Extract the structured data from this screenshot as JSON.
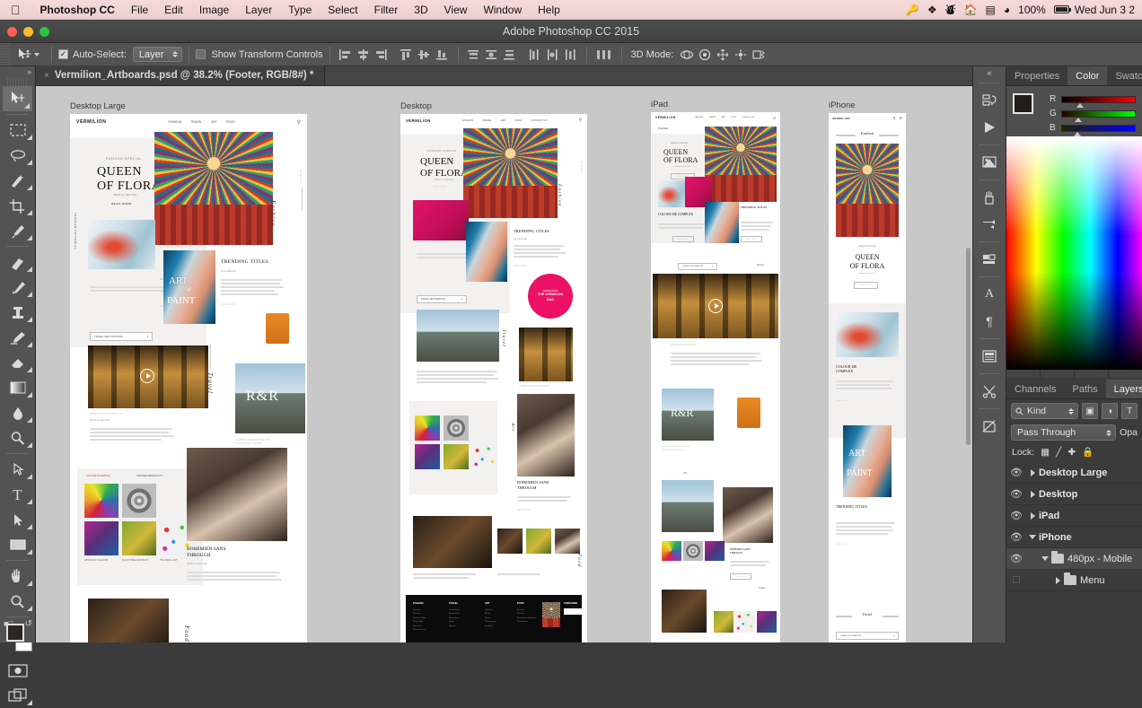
{
  "macmenu": {
    "app": "Photoshop CC",
    "items": [
      "File",
      "Edit",
      "Image",
      "Layer",
      "Type",
      "Select",
      "Filter",
      "3D",
      "View",
      "Window",
      "Help"
    ],
    "status_icons": [
      "keychain-icon",
      "dropbox-icon",
      "creative-cloud-icon",
      "home-icon",
      "airplay-icon",
      "wifi-icon"
    ],
    "battery_percent": "100%",
    "datetime": "Wed Jun 3  2"
  },
  "window": {
    "title": "Adobe Photoshop CC 2015"
  },
  "options": {
    "tool": "move-tool",
    "auto_select_label": "Auto-Select:",
    "auto_select_checked": true,
    "auto_select_value": "Layer",
    "auto_select_options": [
      "Layer",
      "Group"
    ],
    "show_transform_label": "Show Transform Controls",
    "show_transform_checked": false,
    "align_buttons": [
      "align-left-edges",
      "align-horizontal-centers",
      "align-right-edges",
      "align-top-edges",
      "align-vertical-centers",
      "align-bottom-edges"
    ],
    "distribute_buttons": [
      "distribute-top-edges",
      "distribute-vertical-centers",
      "distribute-bottom-edges",
      "distribute-left-edges",
      "distribute-horizontal-centers",
      "distribute-right-edges"
    ],
    "distribute_spacing": "distribute-spacing",
    "mode_3d_label": "3D Mode:",
    "mode_3d_buttons": [
      "orbit-3d",
      "roll-3d",
      "pan-3d",
      "slide-3d",
      "scale-3d"
    ]
  },
  "document": {
    "tab_title": "Vermilion_Artboards.psd @ 38.2% (Footer, RGB/8#) *",
    "close_glyph": "×"
  },
  "toolbar": {
    "tools": [
      {
        "name": "move-tool",
        "active": true
      },
      {
        "name": "rectangular-marquee-tool",
        "active": false
      },
      {
        "name": "lasso-tool",
        "active": false
      },
      {
        "name": "quick-selection-tool",
        "active": false
      },
      {
        "name": "crop-tool",
        "active": false
      },
      {
        "name": "eyedropper-tool",
        "active": false
      },
      {
        "name": "spot-healing-brush-tool",
        "active": false
      },
      {
        "name": "brush-tool",
        "active": false
      },
      {
        "name": "clone-stamp-tool",
        "active": false
      },
      {
        "name": "history-brush-tool",
        "active": false
      },
      {
        "name": "eraser-tool",
        "active": false
      },
      {
        "name": "gradient-tool",
        "active": false
      },
      {
        "name": "blur-tool",
        "active": false
      },
      {
        "name": "dodge-tool",
        "active": false
      },
      {
        "name": "pen-tool",
        "active": false
      },
      {
        "name": "type-tool",
        "active": false
      },
      {
        "name": "path-selection-tool",
        "active": false
      },
      {
        "name": "rectangle-tool",
        "active": false
      },
      {
        "name": "hand-tool",
        "active": false
      },
      {
        "name": "zoom-tool",
        "active": false
      }
    ],
    "type_glyph": "T",
    "foreground_color": "#241c1a",
    "background_color": "#ffffff"
  },
  "rail": {
    "icons": [
      "history-icon",
      "actions-play-icon",
      "adjustments-icon",
      "brush-icon",
      "brush-presets-icon",
      "styles-icon",
      "character-icon",
      "paragraph-icon",
      "libraries-icon",
      "scissors-icon",
      "notes-icon"
    ],
    "character_glyph": "A",
    "paragraph_glyph": "¶",
    "collapse_glyph": "«"
  },
  "color_panel": {
    "tabs": [
      {
        "label": "Properties",
        "active": false
      },
      {
        "label": "Color",
        "active": true
      },
      {
        "label": "Swatches",
        "active": false
      }
    ],
    "channels": [
      {
        "label": "R",
        "value": 36
      },
      {
        "label": "G",
        "value": 28
      },
      {
        "label": "B",
        "value": 26
      }
    ],
    "foreground": "#241c1a",
    "background": "#ffffff"
  },
  "layers_panel": {
    "tabs": [
      {
        "label": "Channels",
        "active": false
      },
      {
        "label": "Paths",
        "active": false
      },
      {
        "label": "Layers",
        "active": true
      }
    ],
    "filter_label": "Kind",
    "filter_icons": [
      "pixel-filter-icon",
      "adjustment-filter-icon",
      "type-filter-icon"
    ],
    "blend_mode": "Pass Through",
    "opacity_label": "Opa",
    "lock_label": "Lock:",
    "lock_icons": [
      "lock-transparent-pixels-icon",
      "lock-image-pixels-icon",
      "lock-position-icon",
      "lock-all-icon"
    ],
    "layers": [
      {
        "name": "Desktop Large",
        "type": "artboard",
        "expanded": false,
        "visible": true,
        "indent": 0,
        "selected": false
      },
      {
        "name": "Desktop",
        "type": "artboard",
        "expanded": false,
        "visible": true,
        "indent": 0,
        "selected": false
      },
      {
        "name": "iPad",
        "type": "artboard",
        "expanded": false,
        "visible": true,
        "indent": 0,
        "selected": false
      },
      {
        "name": "iPhone",
        "type": "artboard",
        "expanded": true,
        "visible": true,
        "indent": 0,
        "selected": false
      },
      {
        "name": "480px - Mobile",
        "type": "group",
        "expanded": true,
        "visible": true,
        "indent": 1,
        "selected": true
      },
      {
        "name": "Menu",
        "type": "group",
        "expanded": false,
        "visible": false,
        "indent": 2,
        "selected": false
      }
    ]
  },
  "canvas": {
    "artboards": [
      {
        "name": "Desktop Large",
        "label": "Desktop Large"
      },
      {
        "name": "Desktop",
        "label": "Desktop"
      },
      {
        "name": "iPad",
        "label": "iPad"
      },
      {
        "name": "iPhone",
        "label": "iPhone"
      }
    ]
  },
  "mockup": {
    "brand": "VERMILION",
    "nav_links": [
      "FASHION",
      "TRAVEL",
      "ART",
      "FOOD",
      "CONTACT US"
    ],
    "hero_eyebrow": "FASHION SPECIAL",
    "hero_title_line1": "QUEEN",
    "hero_title_line2": "OF FLORA",
    "hero_byline": "Words by Jane Doe",
    "hero_cta": "READ MORE",
    "vertical_fashion": "Fashion",
    "vertical_travel": "Travel",
    "vertical_art": "Art",
    "vertical_food": "Food",
    "vertical_scroll": "SCROLL",
    "side_label": "FASHION EDITORIAL",
    "card_colour_title_1": "COLOUR ME",
    "card_colour_title_2": "COMPLEX",
    "card_colour_by": "Jane Doe",
    "card_colour_cta": "READ MORE",
    "trending_title": "TRENDING TITLES",
    "trending_by": "Art & Editorial",
    "trending_cta": "READ MORE",
    "art_overlay_1": "ART",
    "art_overlay_2": "of",
    "art_overlay_3": "PAINT",
    "badge_line1": "INTRODUCING",
    "badge_line2": "THE VERMILION",
    "badge_line3": "BAG",
    "dropdown_label": "TRAVEL DESTINATIONS",
    "video_caption": "BENEATH THE BASILICA",
    "video_by": "Words by Jane Doe",
    "rr_overlay": "R&R",
    "rr_caption_1": "A SIMPLE WEEKEND ESCAPE",
    "rr_caption_2": "TO REAL RELAXATION",
    "gallery_label_1": "COLOUR IN MOTION",
    "gallery_label_2": "PRINTED ABSTRACTS",
    "gallery_cap_1": "ABSTRACT COLOURS",
    "gallery_cap_2": "SCULPTURE ABSTRACT",
    "gallery_cap_3": "THE SMALL ART",
    "dancer_title_1": "BOHEMIEN SANS",
    "dancer_title_2": "THROUGH",
    "dancer_by": "Words by Jane Doe",
    "footer_columns": [
      {
        "heading": "FASHION",
        "links": [
          "Features",
          "Runway",
          "Trends & Style",
          "Street Style",
          "Interviews",
          "Essential Lists"
        ]
      },
      {
        "heading": "TRAVEL",
        "links": [
          "Destinations",
          "Experiences",
          "Restaurants",
          "Hotels",
          "Airports"
        ]
      },
      {
        "heading": "ART",
        "links": [
          "Galleries",
          "Artists",
          "Shows",
          "Photography",
          "Sculpture"
        ]
      },
      {
        "heading": "FOOD",
        "links": [
          "Recipes",
          "Reviews",
          "Restaurant Openings",
          "Chef Stories"
        ]
      }
    ],
    "footer_signup_heading": "SUBSCRIBE",
    "footer_signup_placeholder": "Your email address"
  }
}
